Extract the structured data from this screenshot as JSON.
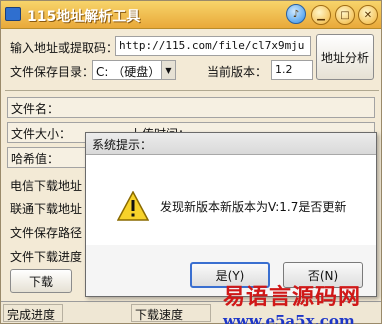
{
  "window": {
    "title": "115地址解析工具",
    "accent": "#e9a93a"
  },
  "form": {
    "address_label": "输入地址或提取码：",
    "address_value": "http://115.com/file/cl7x9mju",
    "save_dir_label": "文件保存目录：",
    "save_dir_value": "C: （硬盘）",
    "version_label": "当前版本：",
    "version_value": "1.2",
    "parse_button": "地址分析"
  },
  "fields": {
    "filename": "文件名：",
    "filesize": "文件大小：",
    "upload_time": "上传时间：",
    "hash": "哈希值：",
    "telecom": "电信下载地址",
    "unicom": "联通下载地址",
    "save_path": "文件保存路径",
    "progress": "文件下载进度"
  },
  "buttons": {
    "download": "下载"
  },
  "statusbar": {
    "left": "完成进度",
    "right": "下载速度"
  },
  "dialog": {
    "title": "系统提示：",
    "message": "发现新版本新版本为V:1.7是否更新",
    "yes": "是(Y)",
    "no": "否(N)"
  },
  "watermark": {
    "name": "易语言源码网",
    "url": "www.e5a5x.com"
  }
}
